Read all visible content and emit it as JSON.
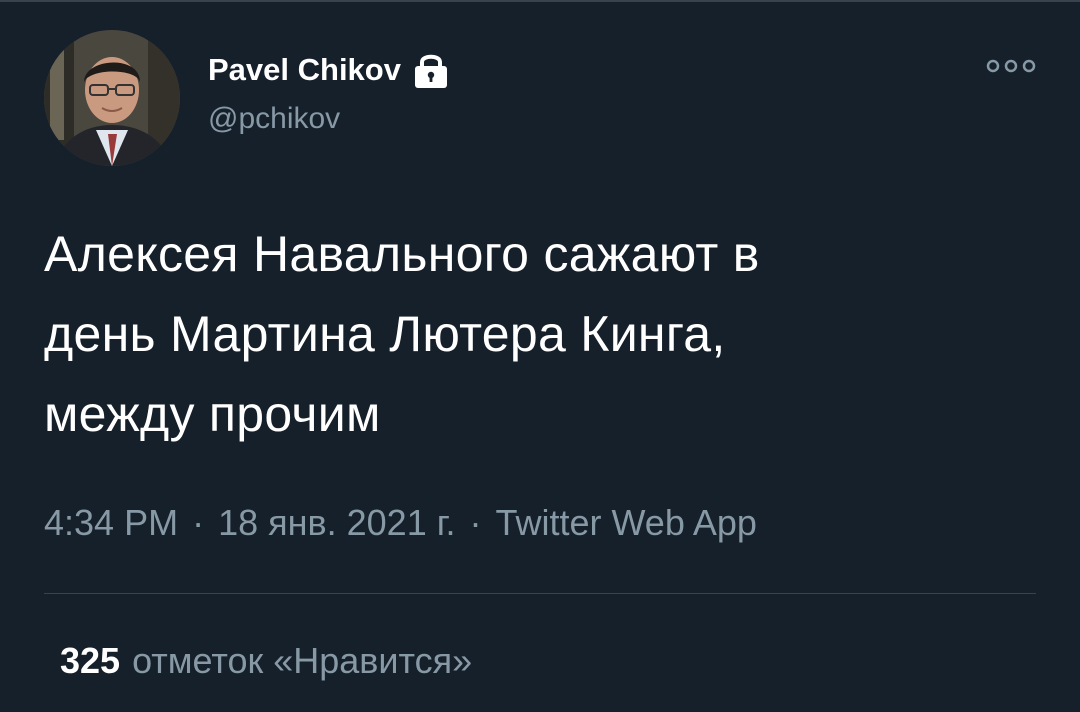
{
  "author": {
    "display_name": "Pavel Chikov",
    "username": "@pchikov",
    "protected_icon": "lock-icon",
    "avatar": "avatar-photo"
  },
  "menu_icon": "more-options-icon",
  "tweet": {
    "text_lines": [
      "Алексея Навального сажают в",
      "день Мартина Лютера Кинга,",
      "между прочим"
    ],
    "time": "4:34 PM",
    "date": "18 янв. 2021 г.",
    "source": "Twitter Web App",
    "separator": "·"
  },
  "stats": {
    "likes_count": "325",
    "likes_label": "отметок «Нравится»"
  },
  "colors": {
    "background": "#15202b",
    "text_primary": "#ffffff",
    "text_secondary": "#8899a6",
    "divider": "#38444d"
  }
}
